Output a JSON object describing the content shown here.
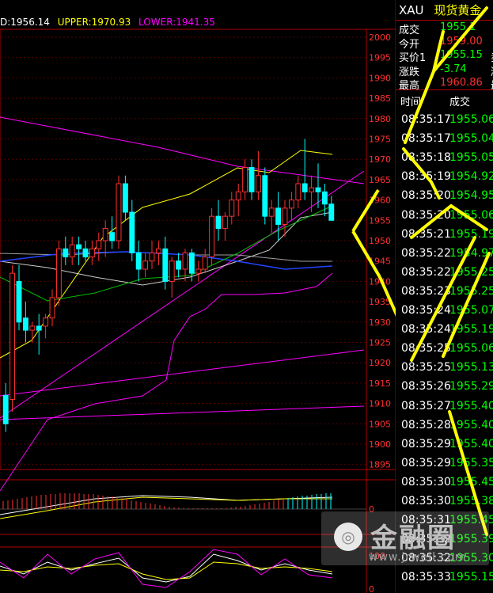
{
  "legend": {
    "mid": "D:1956.14",
    "upper": "UPPER:1970.93",
    "lower": "LOWER:1941.35",
    "colors": {
      "mid": "#ffffff",
      "upper": "#ffff00",
      "lower": "#ff00ff"
    }
  },
  "price_axis": [
    "2000",
    "1995",
    "1990",
    "1985",
    "1980",
    "1975",
    "1970",
    "1965",
    "1960",
    "1955",
    "1950",
    "1945",
    "1940",
    "1935",
    "1930",
    "1925",
    "1920",
    "1915",
    "1910",
    "1905",
    "1900",
    "1895"
  ],
  "macd_axis": [
    "0"
  ],
  "kdj_axis": [
    "100",
    "0"
  ],
  "quote": {
    "code": "XAU",
    "name": "现货黄金",
    "rows": [
      {
        "key": "成交",
        "value": "1955.1",
        "color": "#00ff00",
        "key2": ""
      },
      {
        "key": "今开",
        "value": "1959.00",
        "color": "#ff3030",
        "key2": ""
      },
      {
        "key": "买价1",
        "value": "1955.15",
        "color": "#00ff00",
        "key2": "卖"
      },
      {
        "key": "涨跌",
        "value": "-3.74",
        "color": "#00ff00",
        "key2": "涨"
      },
      {
        "key": "最高",
        "value": "1960.86",
        "color": "#ff3030",
        "key2": "最"
      }
    ]
  },
  "ticks": {
    "header": {
      "time": "时间",
      "price": "成交"
    },
    "rows": [
      {
        "time": "08:35:17",
        "price": "1955.06"
      },
      {
        "time": "08:35:17",
        "price": "1955.04"
      },
      {
        "time": "08:35:18",
        "price": "1955.05"
      },
      {
        "time": "08:35:19",
        "price": "1954.92"
      },
      {
        "time": "08:35:20",
        "price": "1954.95"
      },
      {
        "time": "08:35:20",
        "price": "1955.06"
      },
      {
        "time": "08:35:21",
        "price": "1955.19"
      },
      {
        "time": "08:35:22",
        "price": "1954.97"
      },
      {
        "time": "08:35:22",
        "price": "1955.25"
      },
      {
        "time": "08:35:23",
        "price": "1955.25"
      },
      {
        "time": "08:35:24",
        "price": "1955.07"
      },
      {
        "time": "08:35:24",
        "price": "1955.19"
      },
      {
        "time": "08:35:25",
        "price": "1955.06"
      },
      {
        "time": "08:35:25",
        "price": "1955.13"
      },
      {
        "time": "08:35:26",
        "price": "1955.29"
      },
      {
        "time": "08:35:27",
        "price": "1955.40"
      },
      {
        "time": "08:35:28",
        "price": "1955.40"
      },
      {
        "time": "08:35:29",
        "price": "1955.40"
      },
      {
        "time": "08:35:29",
        "price": "1955.35"
      },
      {
        "time": "08:35:30",
        "price": "1955.45"
      },
      {
        "time": "08:35:30",
        "price": "1955.38"
      },
      {
        "time": "08:35:31",
        "price": "1955.45"
      },
      {
        "time": "08:35:32",
        "price": "1955.39"
      },
      {
        "time": "08:35:32",
        "price": "1955.30"
      },
      {
        "time": "08:35:33",
        "price": "1955.15"
      }
    ]
  },
  "watermark": {
    "text": "金融圈",
    "url": "www.jrwell.com"
  },
  "chart_data": {
    "type": "candlestick",
    "ylim": [
      1893,
      2003
    ],
    "candles": [
      {
        "o": 1912,
        "h": 1915,
        "l": 1903,
        "c": 1905
      },
      {
        "o": 1911,
        "h": 1944,
        "l": 1908,
        "c": 1942
      },
      {
        "o": 1940,
        "h": 1944,
        "l": 1928,
        "c": 1930
      },
      {
        "o": 1931,
        "h": 1935,
        "l": 1925,
        "c": 1928
      },
      {
        "o": 1928,
        "h": 1930,
        "l": 1925,
        "c": 1929
      },
      {
        "o": 1929,
        "h": 1932,
        "l": 1922,
        "c": 1928
      },
      {
        "o": 1929,
        "h": 1932,
        "l": 1926,
        "c": 1931
      },
      {
        "o": 1931,
        "h": 1938,
        "l": 1929,
        "c": 1936
      },
      {
        "o": 1936,
        "h": 1950,
        "l": 1934,
        "c": 1948
      },
      {
        "o": 1948,
        "h": 1951,
        "l": 1944,
        "c": 1946
      },
      {
        "o": 1946,
        "h": 1951,
        "l": 1944,
        "c": 1949
      },
      {
        "o": 1949,
        "h": 1951,
        "l": 1944,
        "c": 1948
      },
      {
        "o": 1948,
        "h": 1950,
        "l": 1945,
        "c": 1946
      },
      {
        "o": 1946,
        "h": 1950,
        "l": 1944,
        "c": 1948
      },
      {
        "o": 1948,
        "h": 1952,
        "l": 1945,
        "c": 1950
      },
      {
        "o": 1950,
        "h": 1955,
        "l": 1946,
        "c": 1953
      },
      {
        "o": 1952,
        "h": 1956,
        "l": 1948,
        "c": 1950
      },
      {
        "o": 1950,
        "h": 1966,
        "l": 1948,
        "c": 1964
      },
      {
        "o": 1964,
        "h": 1966,
        "l": 1955,
        "c": 1957
      },
      {
        "o": 1957,
        "h": 1960,
        "l": 1945,
        "c": 1947
      },
      {
        "o": 1947,
        "h": 1950,
        "l": 1940,
        "c": 1943
      },
      {
        "o": 1943,
        "h": 1947,
        "l": 1941,
        "c": 1945
      },
      {
        "o": 1945,
        "h": 1950,
        "l": 1943,
        "c": 1947
      },
      {
        "o": 1947,
        "h": 1950,
        "l": 1944,
        "c": 1948
      },
      {
        "o": 1948,
        "h": 1951,
        "l": 1938,
        "c": 1940
      },
      {
        "o": 1940,
        "h": 1946,
        "l": 1936,
        "c": 1945
      },
      {
        "o": 1945,
        "h": 1947,
        "l": 1941,
        "c": 1943
      },
      {
        "o": 1943,
        "h": 1948,
        "l": 1940,
        "c": 1947
      },
      {
        "o": 1947,
        "h": 1948,
        "l": 1940,
        "c": 1942
      },
      {
        "o": 1942,
        "h": 1945,
        "l": 1940,
        "c": 1943
      },
      {
        "o": 1943,
        "h": 1948,
        "l": 1942,
        "c": 1946
      },
      {
        "o": 1946,
        "h": 1958,
        "l": 1944,
        "c": 1956
      },
      {
        "o": 1956,
        "h": 1960,
        "l": 1950,
        "c": 1953
      },
      {
        "o": 1953,
        "h": 1957,
        "l": 1950,
        "c": 1956
      },
      {
        "o": 1956,
        "h": 1962,
        "l": 1954,
        "c": 1960
      },
      {
        "o": 1960,
        "h": 1964,
        "l": 1956,
        "c": 1962
      },
      {
        "o": 1962,
        "h": 1970,
        "l": 1960,
        "c": 1968
      },
      {
        "o": 1968,
        "h": 1970,
        "l": 1960,
        "c": 1962
      },
      {
        "o": 1962,
        "h": 1972,
        "l": 1960,
        "c": 1966
      },
      {
        "o": 1966,
        "h": 1968,
        "l": 1954,
        "c": 1956
      },
      {
        "o": 1956,
        "h": 1960,
        "l": 1952,
        "c": 1958
      },
      {
        "o": 1958,
        "h": 1962,
        "l": 1950,
        "c": 1954
      },
      {
        "o": 1954,
        "h": 1960,
        "l": 1951,
        "c": 1958
      },
      {
        "o": 1958,
        "h": 1962,
        "l": 1955,
        "c": 1960
      },
      {
        "o": 1960,
        "h": 1966,
        "l": 1958,
        "c": 1964
      },
      {
        "o": 1964,
        "h": 1975,
        "l": 1960,
        "c": 1962
      },
      {
        "o": 1962,
        "h": 1966,
        "l": 1957,
        "c": 1963
      },
      {
        "o": 1963,
        "h": 1969,
        "l": 1958,
        "c": 1962
      },
      {
        "o": 1962,
        "h": 1964,
        "l": 1956,
        "c": 1959
      },
      {
        "o": 1959,
        "h": 1961,
        "l": 1955,
        "c": 1955
      }
    ]
  }
}
